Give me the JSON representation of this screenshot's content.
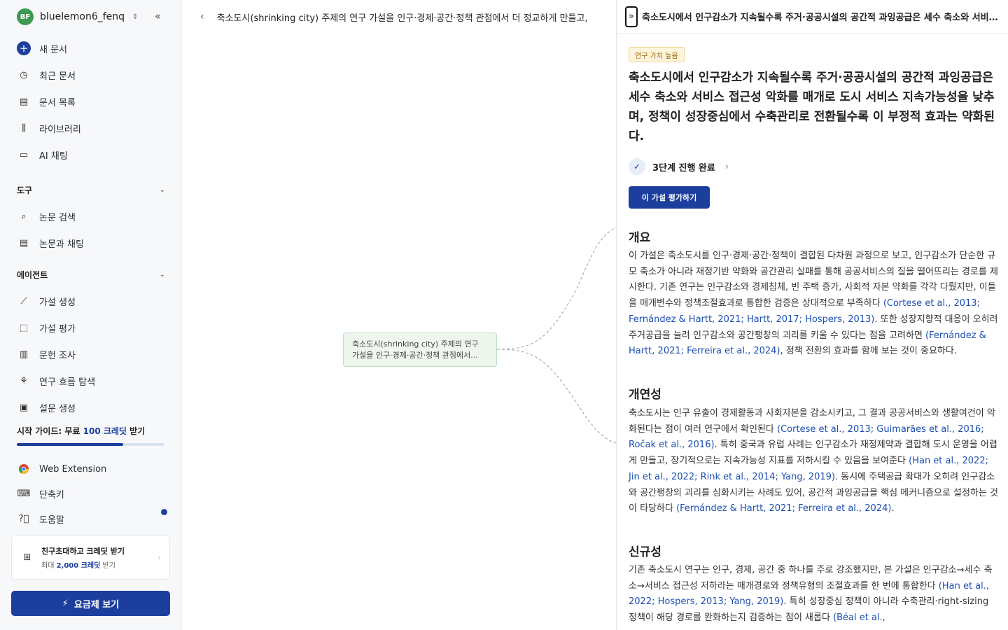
{
  "sidebar": {
    "avatar": "BF",
    "username": "bluelemon6_fenq",
    "nav_main": [
      {
        "label": "새 문서",
        "icon": "plus-circle-icon"
      },
      {
        "label": "최근 문서",
        "icon": "clock-icon"
      },
      {
        "label": "문서 목록",
        "icon": "document-icon"
      },
      {
        "label": "라이브러리",
        "icon": "library-icon"
      },
      {
        "label": "AI 채팅",
        "icon": "chat-icon"
      }
    ],
    "tools_header": "도구",
    "tools": [
      {
        "label": "논문 검색",
        "icon": "search-icon"
      },
      {
        "label": "논문과 채팅",
        "icon": "paper-chat-icon"
      }
    ],
    "agents_header": "에이전트",
    "agents": [
      {
        "label": "가설 생성",
        "icon": "wand-icon"
      },
      {
        "label": "가설 평가",
        "icon": "dashed-box-icon"
      },
      {
        "label": "문헌 조사",
        "icon": "literature-icon"
      },
      {
        "label": "연구 흐름 탐색",
        "icon": "flow-icon"
      },
      {
        "label": "설문 생성",
        "icon": "clipboard-icon"
      }
    ],
    "guide_prefix": "시작 가이드: 무료 ",
    "guide_highlight": "100 크레딧",
    "guide_suffix": " 받기",
    "guide_progress": 0.72,
    "bottom": [
      {
        "label": "Web Extension",
        "icon": "chrome-icon"
      },
      {
        "label": "단축키",
        "icon": "keyboard-icon"
      },
      {
        "label": "도움말",
        "icon": "help-icon"
      }
    ],
    "invite_title": "친구초대하고 크레딧 받기",
    "invite_sub_prefix": "최대 ",
    "invite_sub_amount": "2,000 크레딧",
    "invite_sub_suffix": " 받기",
    "plan_button": "요금제 보기"
  },
  "canvas": {
    "title": "축소도시(shrinking city) 주제의 연구 가설을 인구·경제·공간·정책 관점에서 더 정교하게 만들고,",
    "node_text": "축소도시(shrinking city) 주제의 연구 가설을 인구·경제·공간·정책 관점에서..."
  },
  "panel": {
    "header_title": "축소도시에서 인구감소가 지속될수록 주거·공공시설의 공간적 과잉공급은 세수 축소와 서비스 접근성 악화를 매개로 도시 서비스 지속가능성을 낮추며, 정책이 성장중심에서 수축관리로 전환될수록 이 부정적 효과는 약화된다.",
    "badge": "연구 가치 높음",
    "hypothesis": "축소도시에서 인구감소가 지속될수록 주거·공공시설의 공간적 과잉공급은 세수 축소와 서비스 접근성 악화를 매개로 도시 서비스 지속가능성을 낮추며, 정책이 성장중심에서 수축관리로 전환될수록 이 부정적 효과는 약화된다.",
    "step_status": "3단계 진행 완료",
    "evaluate_button": "이 가설 평가하기",
    "sections": [
      {
        "heading": "개요",
        "segments": [
          {
            "t": "이 가설은 축소도시를 인구·경제·공간·정책이 결합된 다차원 과정으로 보고, 인구감소가 단순한 규모 축소가 아니라 재정기반 약화와 공간관리 실패를 통해 공공서비스의 질을 떨어뜨리는 경로를 제시한다. 기존 연구는 인구감소와 경제침체, 빈 주택 증가, 사회적 자본 약화를 각각 다뤘지만, 이들을 매개변수와 정책조절효과로 통합한 검증은 상대적으로 부족하다 ",
            "c": false
          },
          {
            "t": "(Cortese et al., 2013; Fernández & Hartt, 2021; Hartt, 2017; Hospers, 2013)",
            "c": true
          },
          {
            "t": ". 또한 성장지향적 대응이 오히려 주거공급을 늘려 인구감소와 공간팽창의 괴리를 키울 수 있다는 점을 고려하면 ",
            "c": false
          },
          {
            "t": "(Fernández & Hartt, 2021; Ferreira et al., 2024)",
            "c": true
          },
          {
            "t": ", 정책 전환의 효과를 함께 보는 것이 중요하다.",
            "c": false
          }
        ]
      },
      {
        "heading": "개연성",
        "segments": [
          {
            "t": "축소도시는 인구 유출이 경제활동과 사회자본을 감소시키고, 그 결과 공공서비스와 생활여건이 악화된다는 점이 여러 연구에서 확인된다 ",
            "c": false
          },
          {
            "t": "(Cortese et al., 2013; Guimarães et al., 2016; Ročak et al., 2016)",
            "c": true
          },
          {
            "t": ". 특히 중국과 유럽 사례는 인구감소가 재정제약과 결합해 도시 운영을 어렵게 만들고, 장기적으로는 지속가능성 지표를 저하시킬 수 있음을 보여준다 ",
            "c": false
          },
          {
            "t": "(Han et al., 2022; Jin et al., 2022; Rink et al., 2014; Yang, 2019)",
            "c": true
          },
          {
            "t": ". 동시에 주택공급 확대가 오히려 인구감소와 공간팽창의 괴리를 심화시키는 사례도 있어, 공간적 과잉공급을 핵심 메커니즘으로 설정하는 것이 타당하다 ",
            "c": false
          },
          {
            "t": "(Fernández & Hartt, 2021; Ferreira et al., 2024)",
            "c": true
          },
          {
            "t": ".",
            "c": false
          }
        ]
      },
      {
        "heading": "신규성",
        "segments": [
          {
            "t": "기존 축소도시 연구는 인구, 경제, 공간 중 하나를 주로 강조했지만, 본 가설은 인구감소→세수 축소→서비스 접근성 저하라는 매개경로와 정책유형의 조절효과를 한 번에 통합한다 ",
            "c": false
          },
          {
            "t": "(Han et al., 2022; Hospers, 2013; Yang, 2019)",
            "c": true
          },
          {
            "t": ". 특히 성장중심 정책이 아니라 수축관리·right-sizing 정책이 해당 경로를 완화하는지 검증하는 점이 새롭다 ",
            "c": false
          },
          {
            "t": "(Béal et al.,",
            "c": true
          }
        ]
      }
    ]
  }
}
